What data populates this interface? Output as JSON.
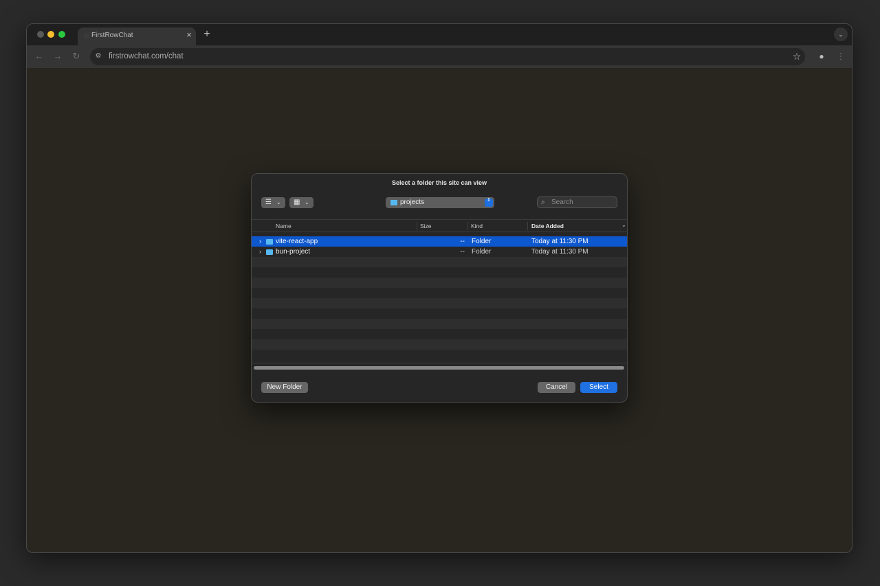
{
  "browser": {
    "tab_title": "FirstRowChat",
    "tab_close_glyph": "×",
    "new_tab_glyph": "+",
    "url": "firstrowchat.com/chat",
    "icons": {
      "back": "←",
      "forward": "→",
      "reload": "↻",
      "site_info": "⚙",
      "bookmark": "☆",
      "profile": "●",
      "menu": "⋮",
      "tab_menu": "⌄"
    }
  },
  "dialog": {
    "title": "Select a folder this site can view",
    "view_buttons": {
      "list_icon": "☰",
      "grid_icon": "▦",
      "caret": "⌄"
    },
    "location": "projects",
    "location_stepper": "⇕",
    "search_placeholder": "Search",
    "search_icon": "⌕",
    "columns": {
      "name": "Name",
      "size": "Size",
      "kind": "Kind",
      "date_added": "Date Added"
    },
    "sort_caret": "⌄",
    "disclosure_glyph": "›",
    "rows": [
      {
        "name": "vite-react-app",
        "size": "--",
        "kind": "Folder",
        "date": "Today at 11:30 PM",
        "selected": true
      },
      {
        "name": "bun-project",
        "size": "--",
        "kind": "Folder",
        "date": "Today at 11:30 PM",
        "selected": false
      }
    ],
    "buttons": {
      "new_folder": "New Folder",
      "cancel": "Cancel",
      "select": "Select"
    }
  },
  "colors": {
    "accent": "#1f70e0",
    "selection": "#0e58cf",
    "folder": "#57b8f0"
  }
}
